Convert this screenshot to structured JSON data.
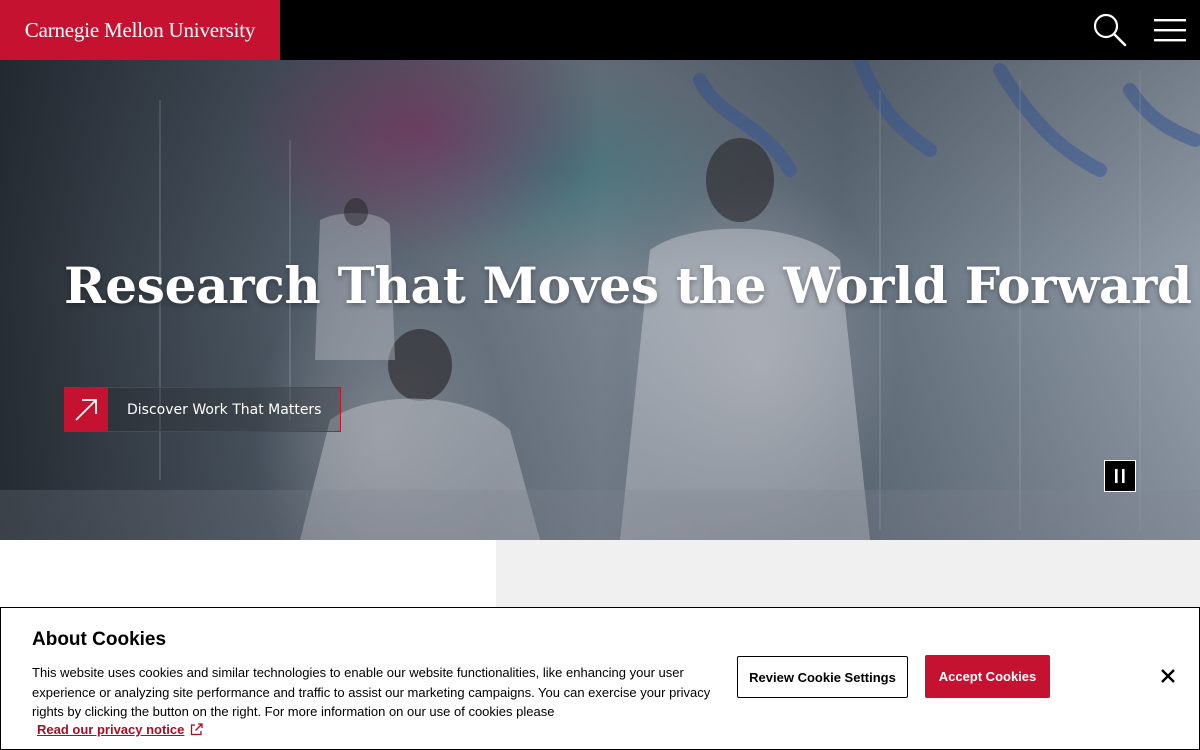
{
  "header": {
    "logo_text": "Carnegie Mellon University",
    "search_icon": "search-icon",
    "menu_icon": "hamburger-menu-icon"
  },
  "hero": {
    "title": "Research That Moves the World Forward",
    "cta_label": "Discover Work That Matters",
    "cta_icon": "arrow-up-right-icon",
    "pause_icon": "pause-icon"
  },
  "cookie_banner": {
    "title": "About Cookies",
    "body": "This website uses cookies and similar technologies to enable our website functionalities, like enhancing your user experience or analyzing site performance and traffic to assist our marketing campaigns. You can exercise your privacy rights by clicking the button on the right. For more information on our use of cookies please",
    "privacy_link": "Read our privacy notice",
    "privacy_link_icon": "external-link-icon",
    "review_button": "Review Cookie Settings",
    "accept_button": "Accept Cookies",
    "close_icon": "close-icon"
  },
  "colors": {
    "brand_red": "#c41230",
    "header_bg": "#000000",
    "link_red": "#a50f26"
  }
}
